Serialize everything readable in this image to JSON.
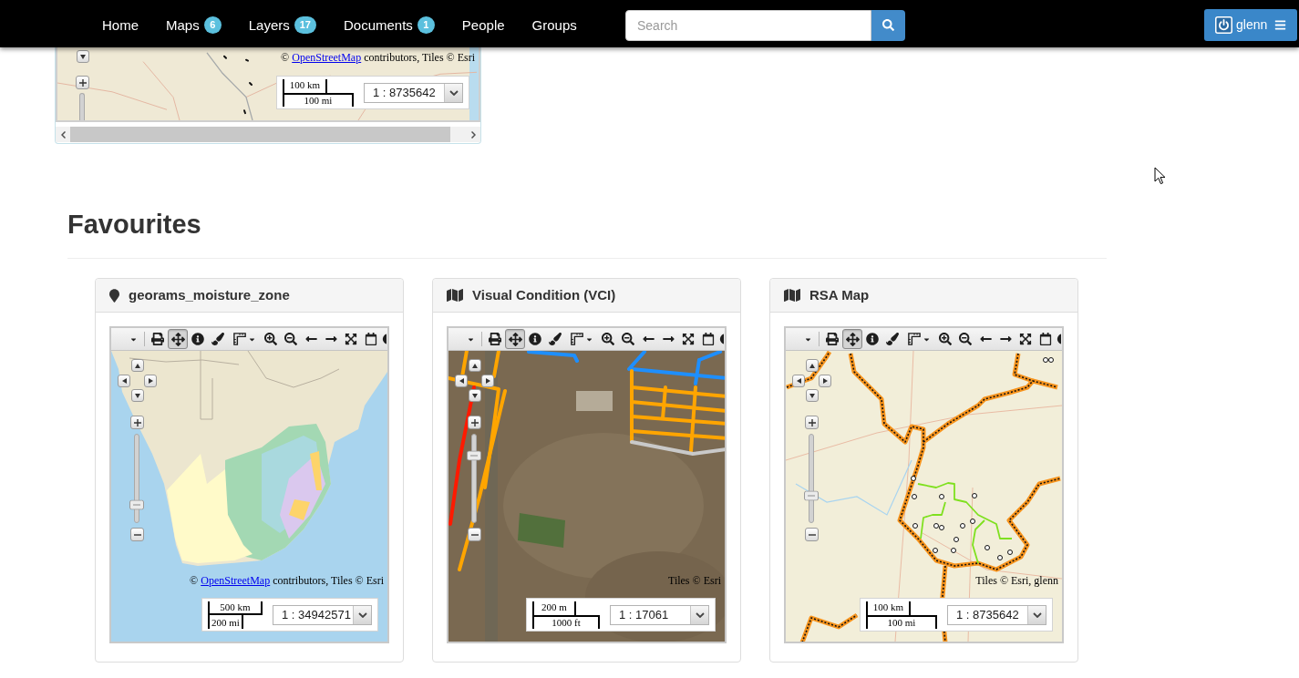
{
  "navbar": {
    "links": [
      {
        "label": "Home"
      },
      {
        "label": "Maps",
        "badge": "6"
      },
      {
        "label": "Layers",
        "badge": "17"
      },
      {
        "label": "Documents",
        "badge": "1"
      },
      {
        "label": "People"
      },
      {
        "label": "Groups"
      }
    ],
    "search": {
      "placeholder": "Search"
    },
    "user": {
      "name": "glenn"
    }
  },
  "top_map": {
    "kind": "overview",
    "attribution": [
      {
        "kind": "text",
        "text": "©"
      },
      {
        "kind": "link",
        "text": "OpenStreetMap"
      },
      {
        "kind": "text",
        "text": "contributors, Tiles © Esri"
      }
    ],
    "scale": {
      "top": "100 km",
      "bottom": "100 mi",
      "ratio": "1 : 8735642"
    }
  },
  "section": {
    "title": "Favourites"
  },
  "favourites": [
    {
      "kind": "layer",
      "title": "georams_moisture_zone",
      "map": {
        "kind": "terrain",
        "toolbar": [
          {
            "kind": "menu",
            "selected": false
          },
          {
            "kind": "print",
            "selected": false
          },
          {
            "kind": "pan",
            "selected": true
          },
          {
            "kind": "info",
            "selected": false
          },
          {
            "kind": "style",
            "selected": false
          },
          {
            "kind": "measure",
            "selected": false
          },
          {
            "kind": "zoomin",
            "selected": false
          },
          {
            "kind": "zoomout",
            "selected": false
          },
          {
            "kind": "back",
            "selected": false
          },
          {
            "kind": "forward",
            "selected": false
          },
          {
            "kind": "extent",
            "selected": false
          },
          {
            "kind": "time",
            "selected": false
          },
          {
            "kind": "globe",
            "selected": false
          }
        ],
        "zoom_slider": {
          "level": 0.2
        },
        "attribution": [
          {
            "kind": "text",
            "text": "©"
          },
          {
            "kind": "link",
            "text": "OpenStreetMap"
          },
          {
            "kind": "text",
            "text": "contributors, Tiles © Esri"
          }
        ],
        "scale": {
          "top": "500 km",
          "bottom": "200 mi",
          "ratio": "1 : 34942571"
        }
      }
    },
    {
      "kind": "map",
      "title": "Visual Condition (VCI)",
      "map": {
        "kind": "satellite",
        "toolbar": [
          {
            "kind": "menu",
            "selected": false
          },
          {
            "kind": "print",
            "selected": false
          },
          {
            "kind": "pan",
            "selected": true
          },
          {
            "kind": "info",
            "selected": false
          },
          {
            "kind": "style",
            "selected": false
          },
          {
            "kind": "measure",
            "selected": false
          },
          {
            "kind": "zoomin",
            "selected": false
          },
          {
            "kind": "zoomout",
            "selected": false
          },
          {
            "kind": "back",
            "selected": false
          },
          {
            "kind": "forward",
            "selected": false
          },
          {
            "kind": "extent",
            "selected": false
          },
          {
            "kind": "time",
            "selected": false
          },
          {
            "kind": "globe",
            "selected": false
          }
        ],
        "zoom_slider": {
          "level": 0.76
        },
        "attribution": [
          {
            "kind": "text",
            "text": "Tiles © Esri"
          }
        ],
        "scale": {
          "top": "200 m",
          "bottom": "1000 ft",
          "ratio": "1 : 17061"
        }
      }
    },
    {
      "kind": "map",
      "title": "RSA Map",
      "map": {
        "kind": "regions",
        "toolbar": [
          {
            "kind": "menu",
            "selected": false
          },
          {
            "kind": "print",
            "selected": false
          },
          {
            "kind": "pan",
            "selected": true
          },
          {
            "kind": "info",
            "selected": false
          },
          {
            "kind": "style",
            "selected": false
          },
          {
            "kind": "measure",
            "selected": false
          },
          {
            "kind": "zoomin",
            "selected": false
          },
          {
            "kind": "zoomout",
            "selected": false
          },
          {
            "kind": "back",
            "selected": false
          },
          {
            "kind": "forward",
            "selected": false
          },
          {
            "kind": "extent",
            "selected": false
          },
          {
            "kind": "time",
            "selected": false
          },
          {
            "kind": "globe",
            "selected": false
          }
        ],
        "zoom_slider": {
          "level": 0.31
        },
        "attribution": [
          {
            "kind": "text",
            "text": "Tiles © Esri, glenn"
          }
        ],
        "scale": {
          "top": "100 km",
          "bottom": "100 mi",
          "ratio": "1 : 8735642"
        }
      }
    }
  ]
}
